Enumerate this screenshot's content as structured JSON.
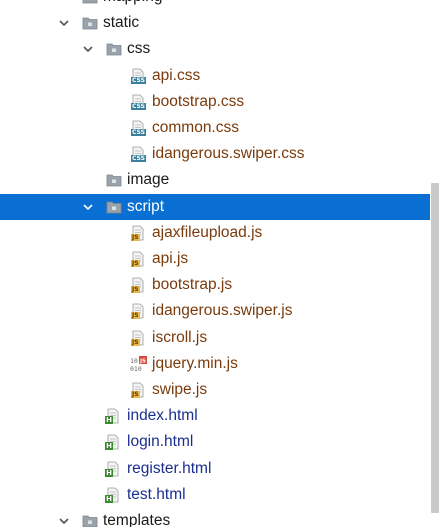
{
  "tree": [
    {
      "label": "mapping",
      "type": "folder",
      "depth": 0,
      "expanded": false,
      "partial_top": true
    },
    {
      "label": "static",
      "type": "folder",
      "depth": 0,
      "expanded": true
    },
    {
      "label": "css",
      "type": "folder",
      "depth": 1,
      "expanded": true
    },
    {
      "label": "api.css",
      "type": "css",
      "depth": 2
    },
    {
      "label": "bootstrap.css",
      "type": "css",
      "depth": 2
    },
    {
      "label": "common.css",
      "type": "css",
      "depth": 2
    },
    {
      "label": "idangerous.swiper.css",
      "type": "css",
      "depth": 2
    },
    {
      "label": "image",
      "type": "folder",
      "depth": 1,
      "expanded": false,
      "no_chevron": true
    },
    {
      "label": "script",
      "type": "folder",
      "depth": 1,
      "expanded": true,
      "selected": true
    },
    {
      "label": "ajaxfileupload.js",
      "type": "js",
      "depth": 2
    },
    {
      "label": "api.js",
      "type": "js",
      "depth": 2
    },
    {
      "label": "bootstrap.js",
      "type": "js",
      "depth": 2
    },
    {
      "label": "idangerous.swiper.js",
      "type": "js",
      "depth": 2
    },
    {
      "label": "iscroll.js",
      "type": "js",
      "depth": 2
    },
    {
      "label": "jquery.min.js",
      "type": "minjs",
      "depth": 2
    },
    {
      "label": "swipe.js",
      "type": "js",
      "depth": 2
    },
    {
      "label": "index.html",
      "type": "html",
      "depth": 1
    },
    {
      "label": "login.html",
      "type": "html",
      "depth": 1
    },
    {
      "label": "register.html",
      "type": "html",
      "depth": 1
    },
    {
      "label": "test.html",
      "type": "html",
      "depth": 1
    },
    {
      "label": "templates",
      "type": "folder",
      "depth": 0,
      "expanded": true
    }
  ],
  "colors": {
    "selection": "#0a6fd2",
    "css_text": "#7a3b0c",
    "js_text": "#7a3b0c",
    "html_text": "#1b2f8f",
    "folder_text": "#1a1a1a"
  },
  "icons": {
    "folder": "folder-icon",
    "css": "css-file-icon",
    "js": "js-file-icon",
    "minjs": "minified-js-file-icon",
    "html": "html-file-icon"
  }
}
